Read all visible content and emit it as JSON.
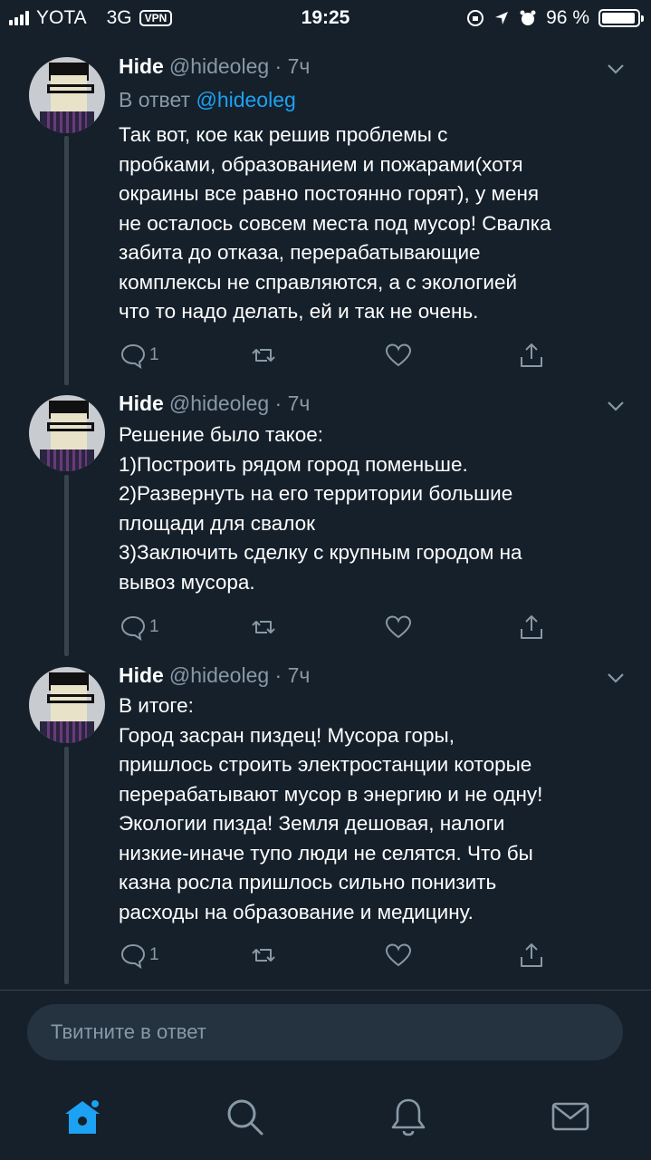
{
  "status_bar": {
    "carrier": "YOTA",
    "network": "3G",
    "vpn": "VPN",
    "time": "19:25",
    "battery": "96 %",
    "battery_level": 0.96
  },
  "tweets": [
    {
      "name": "Hide",
      "handle": "@hideoleg · 7ч",
      "reply_prefix": "В ответ",
      "reply_to": "@hideoleg",
      "text": "Так вот, кое как решив проблемы с\nпробками, образованием и пожарами(хотя\nокраины все равно постоянно горят), у меня\nне осталось совсем места под мусор! Свалка\nзабита до отказа, перерабатывающие\nкомплексы не справляются, а с экологией\nчто то надо делать, ей и так не очень.",
      "reply_count": "1"
    },
    {
      "name": "Hide",
      "handle": "@hideoleg · 7ч",
      "text": "Решение было такое:\n1)Построить рядом город поменьше.\n2)Развернуть на его территории большие\nплощади для свалок\n3)Заключить сделку с крупным городом на\nвывоз мусора.",
      "reply_count": "1"
    },
    {
      "name": "Hide",
      "handle": "@hideoleg · 7ч",
      "text": "В итоге:\nГород засран пиздец! Мусора горы,\nпришлось строить электростанции которые\nперерабатывают мусор в энергию и не одну!\nЭкологии пизда! Земля дешовая, налоги\nнизкие-иначе тупо люди не селятся. Что бы\nказна росла пришлось сильно понизить\nрасходы на образование и медицину.",
      "reply_count": "1"
    }
  ],
  "compose": {
    "placeholder": "Твитните в ответ"
  },
  "tabbar": {
    "items": [
      "home-icon",
      "search-icon",
      "notifications-icon",
      "messages-icon"
    ],
    "active_color": "#1da1f2",
    "inactive_color": "#8899a6"
  }
}
